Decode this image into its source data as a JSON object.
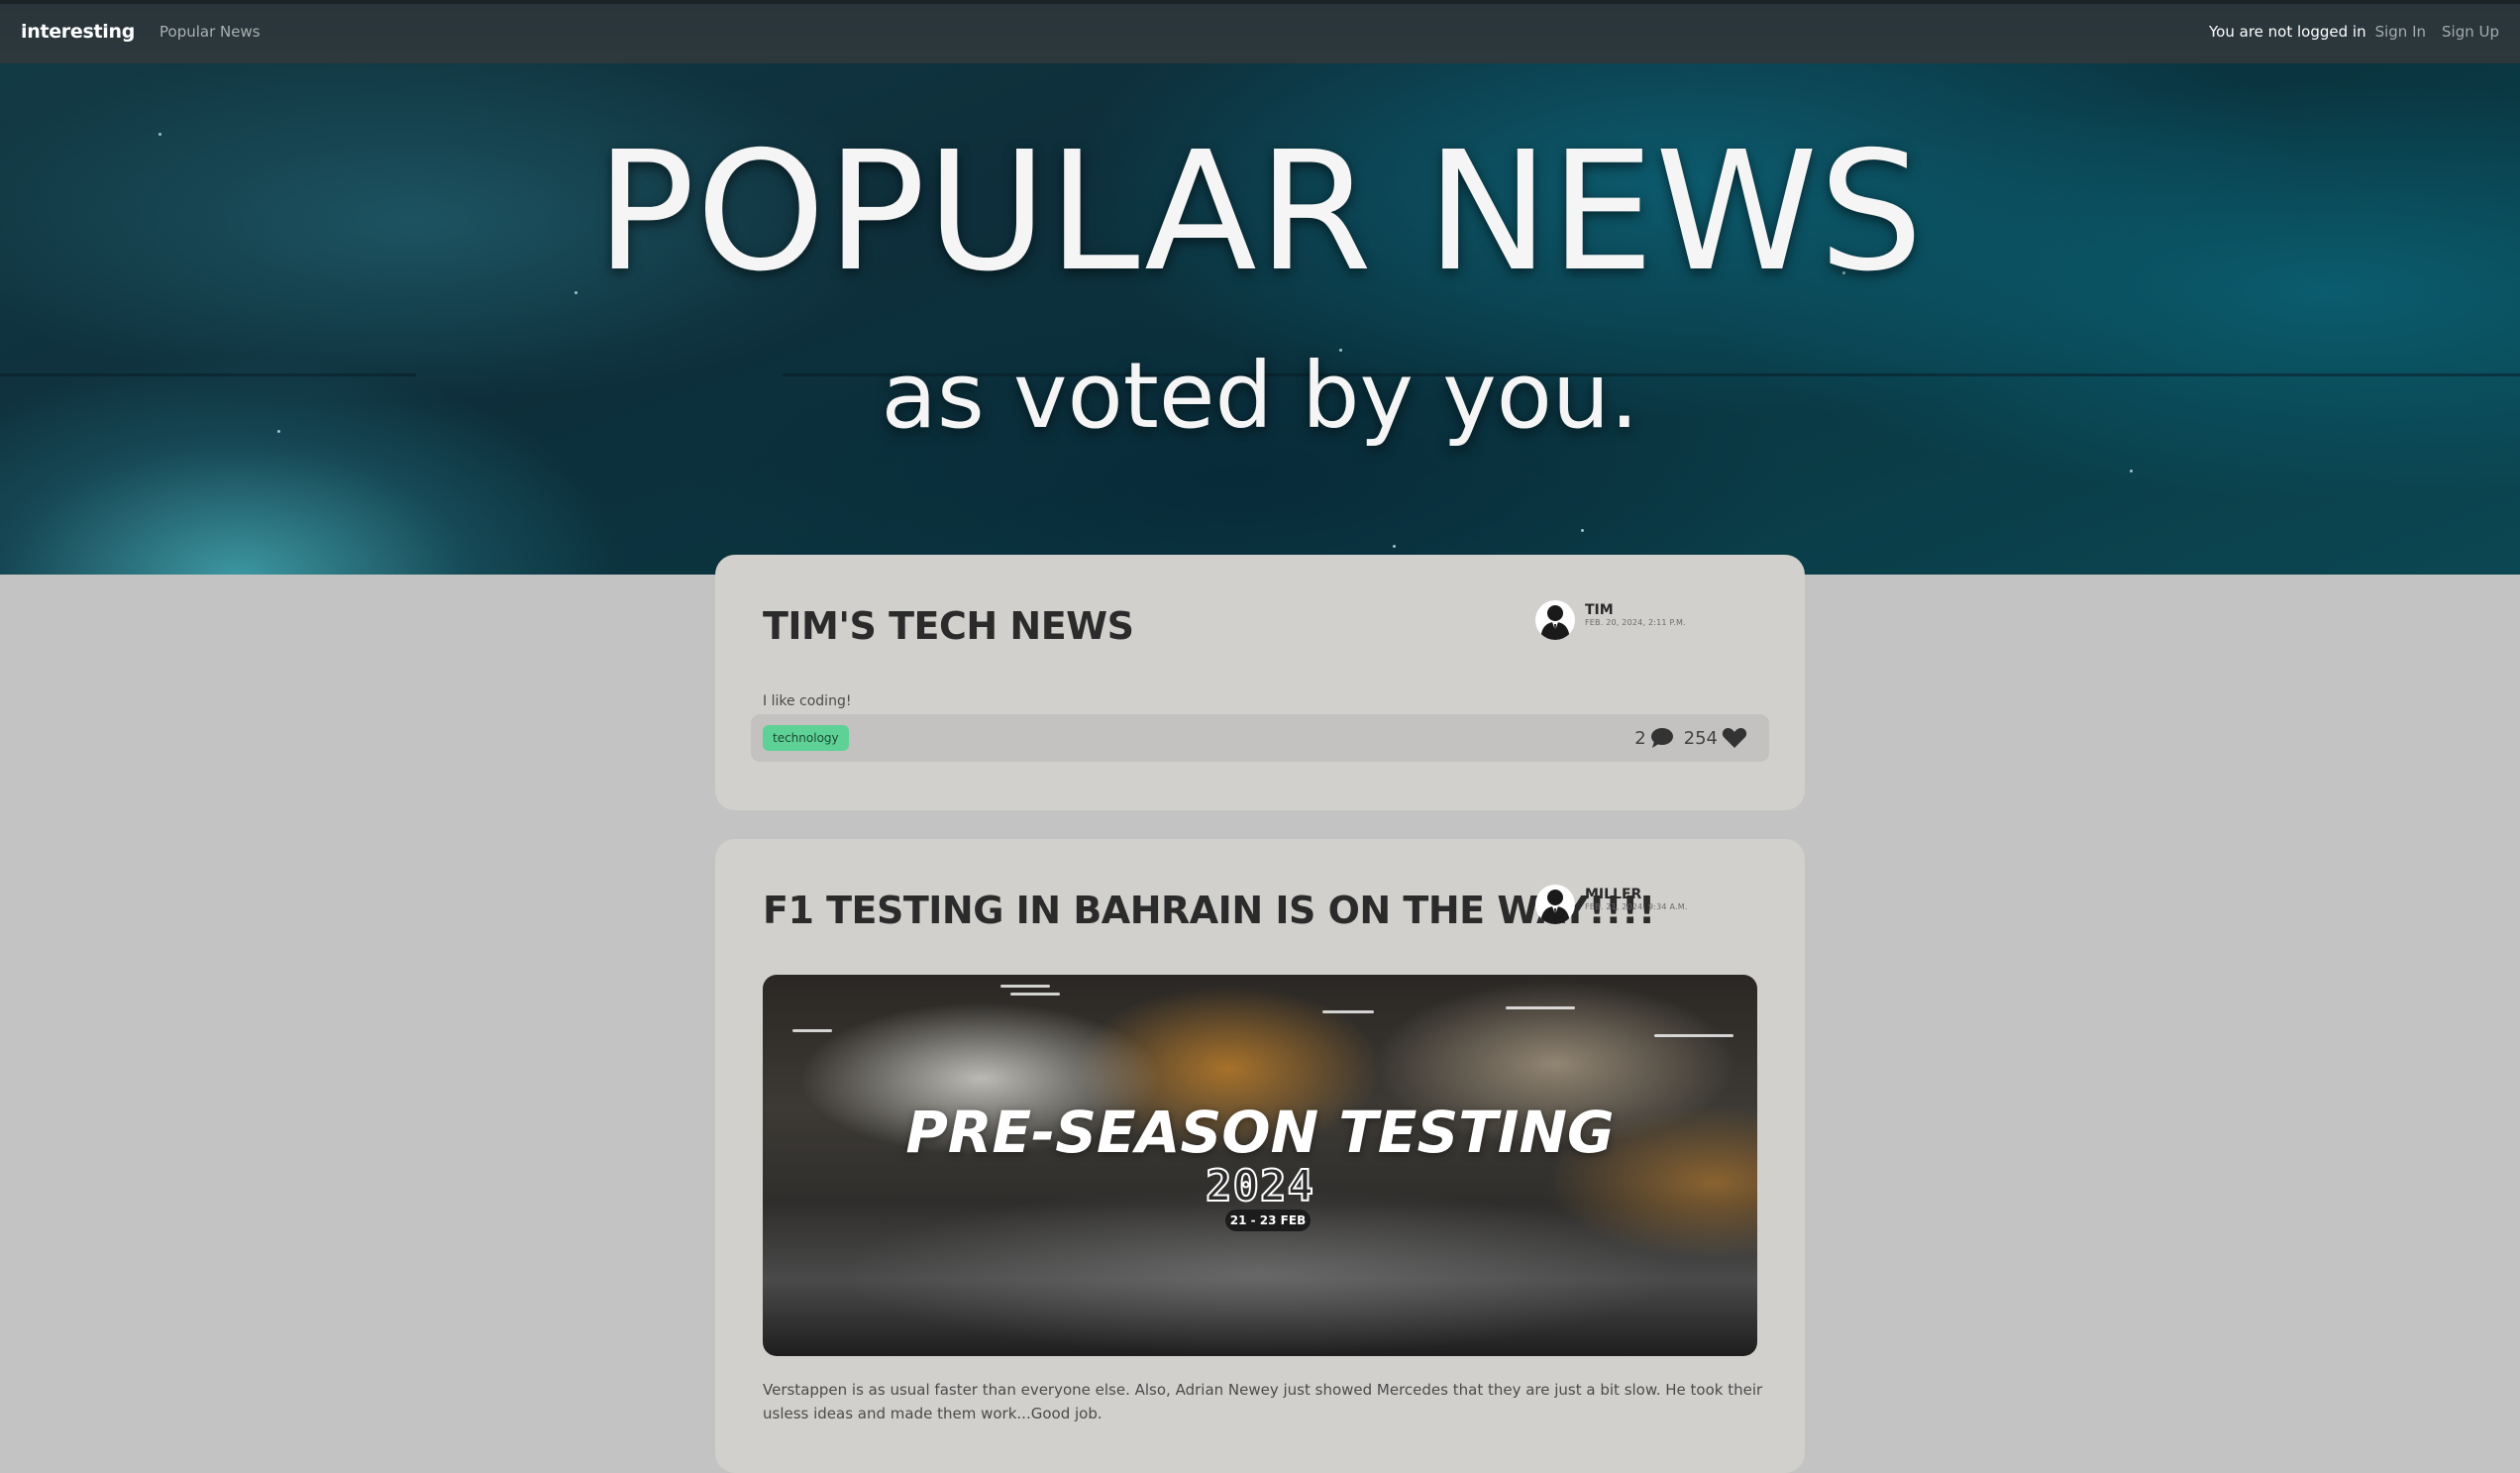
{
  "navbar": {
    "brand": "interesting",
    "link_popular": "Popular News",
    "status": "You are not logged in",
    "sign_in": "Sign In",
    "sign_up": "Sign Up"
  },
  "hero": {
    "title": "POPULAR NEWS",
    "subtitle": "as voted by you."
  },
  "posts": [
    {
      "title": "TIM'S TECH NEWS",
      "author": "TIM",
      "date": "FEB. 20, 2024, 2:11 P.M.",
      "description": "I like coding!",
      "tag": "technology",
      "comments": "2",
      "likes": "254"
    },
    {
      "title": "F1 TESTING IN BAHRAIN IS ON THE WAY!!!!",
      "author": "MILLER",
      "date": "FEB. 21, 2024, 9:34 A.M.",
      "image": {
        "title": "PRE-SEASON TESTING",
        "year": "2024",
        "dates": "21 - 23 FEB"
      },
      "body": "Verstappen is as usual faster than everyone else. Also, Adrian Newey just showed Mercedes that they are just a bit slow. He took their usless ideas and made them work...Good job."
    }
  ],
  "colors": {
    "navbar": "#2c383c",
    "page_background": "#c3c3c3",
    "card_background": "#d1d0cd",
    "tag_green": "#5ed196"
  },
  "icons": [
    "user-silhouette-icon",
    "comment-icon",
    "heart-icon"
  ]
}
